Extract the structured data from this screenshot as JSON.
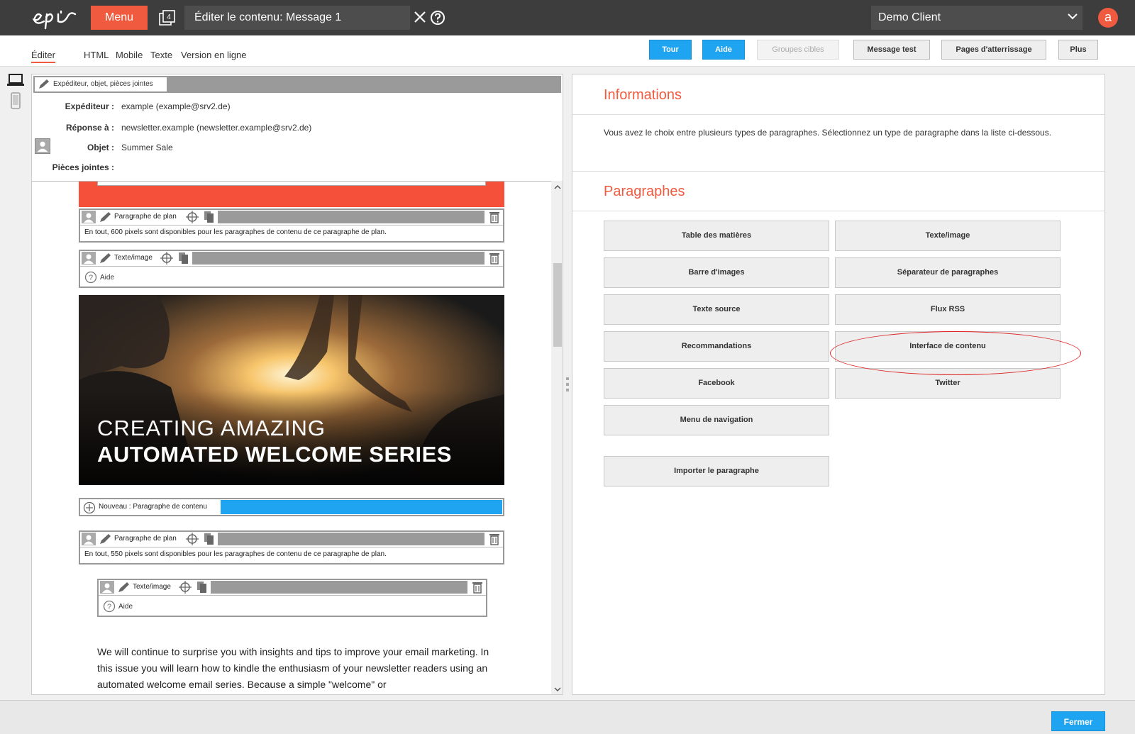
{
  "topbar": {
    "menu_label": "Menu",
    "stack_count": "4",
    "editor_title": "Éditer le contenu: Message 1",
    "client_name": "Demo Client",
    "avatar_letter": "a"
  },
  "tabs": [
    {
      "label": "Éditer",
      "active": true
    },
    {
      "label": "HTML"
    },
    {
      "label": "Mobile"
    },
    {
      "label": "Texte"
    },
    {
      "label": "Version en ligne"
    }
  ],
  "toolbar": {
    "tour": "Tour",
    "aide": "Aide",
    "groupes": "Groupes cibles",
    "message_test": "Message test",
    "pages": "Pages d'atterrissage",
    "plus": "Plus"
  },
  "editor": {
    "header_label": "Expéditeur, objet, pièces jointes",
    "meta": {
      "sender_key": "Expéditeur :",
      "sender_val": "example (example@srv2.de)",
      "reply_key": "Réponse à :",
      "reply_val": "newsletter.example (newsletter.example@srv2.de)",
      "subject_key": "Objet :",
      "subject_val": "Summer Sale",
      "attach_key": "Pièces jointes :"
    },
    "blocks": {
      "plan1_label": "Paragraphe de plan",
      "plan1_info": "En tout, 600 pixels sont disponibles pour les paragraphes de contenu de ce paragraphe de plan.",
      "textimg1_label": "Texte/image",
      "help_label": "Aide",
      "new_label": "Nouveau : Paragraphe de contenu",
      "plan2_label": "Paragraphe de plan",
      "plan2_info": "En tout, 550 pixels sont disponibles pour les paragraphes de contenu de ce paragraphe de plan.",
      "textimg2_label": "Texte/image",
      "help2_label": "Aide"
    },
    "hero": {
      "line1": "CREATING AMAZING",
      "line2": "AUTOMATED WELCOME SERIES"
    },
    "body_text": "We will continue to surprise you with insights and tips to improve your email marketing. In this issue you will learn how to kindle the enthusiasm of your newsletter readers using an automated welcome email series. Because a simple \"welcome\" or"
  },
  "right": {
    "info_title": "Informations",
    "info_text": "Vous avez le choix entre plusieurs types de paragraphes. Sélectionnez un type de paragraphe dans la liste ci-dessous.",
    "para_title": "Paragraphes",
    "buttons": [
      "Table des matières",
      "Texte/image",
      "Barre d'images",
      "Séparateur de paragraphes",
      "Texte source",
      "Flux RSS",
      "Recommandations",
      "Interface de contenu",
      "Facebook",
      "Twitter",
      "Menu de navigation"
    ],
    "import_label": "Importer le paragraphe"
  },
  "footer": {
    "close_label": "Fermer"
  },
  "colors": {
    "accent": "#f05a3f",
    "blue": "#1ea4f0",
    "dark": "#3d3d3d"
  }
}
